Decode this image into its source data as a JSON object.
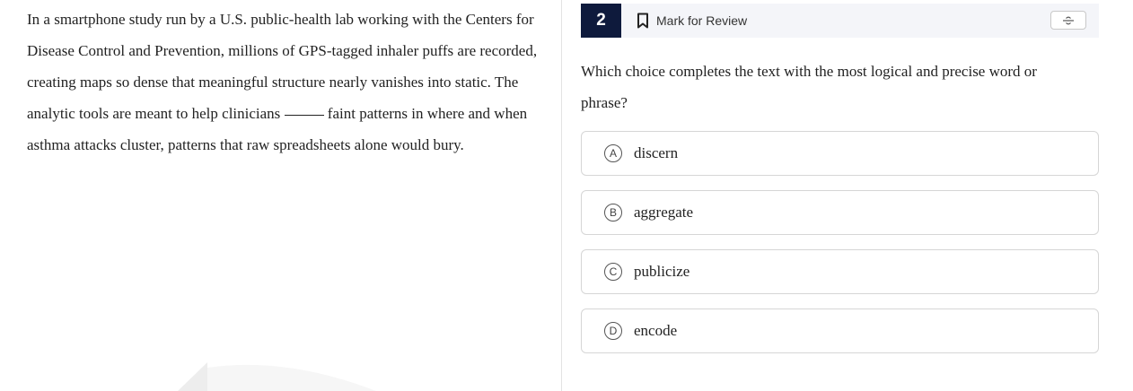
{
  "passage": {
    "before_blank": "In a smartphone study run by a U.S. public-health lab working with the Centers for Disease Control and Prevention, millions of GPS-tagged inhaler puffs are recorded, creating maps so dense that meaningful structure nearly vanishes into static. The analytic tools are meant to help clinicians ",
    "after_blank": " faint patterns in where and when asthma attacks cluster, patterns that raw spreadsheets alone would bury."
  },
  "question_header": {
    "number": "2",
    "mark_for_review_label": "Mark for Review",
    "bookmark_icon": "bookmark-icon",
    "strikethrough_icon": "strikethrough-toggle-icon"
  },
  "question": {
    "prompt": "Which choice completes the text with the most logical and precise word or phrase?"
  },
  "choices": [
    {
      "letter": "A",
      "text": "discern"
    },
    {
      "letter": "B",
      "text": "aggregate"
    },
    {
      "letter": "C",
      "text": "publicize"
    },
    {
      "letter": "D",
      "text": "encode"
    }
  ],
  "colors": {
    "question_number_bg": "#0e1a3c",
    "header_bar_bg": "#f4f5f9",
    "choice_border": "#d6d6d6"
  }
}
